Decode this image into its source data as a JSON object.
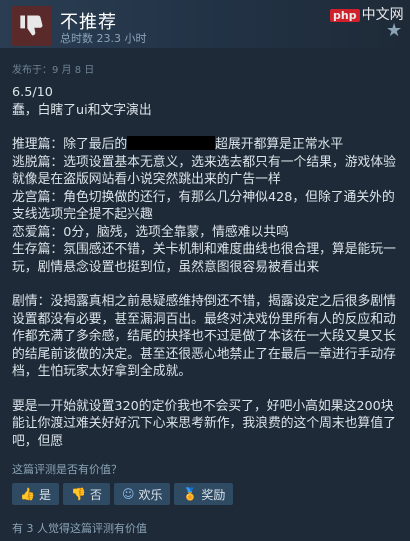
{
  "header": {
    "title": "不推荐",
    "hours": "总时数 23.3 小时",
    "watermark_tag": "php",
    "watermark_text": "中文网"
  },
  "posted": "发布于：9 月 8 日",
  "body": {
    "line1": "6.5/10",
    "line2": "蠢，白瞎了ui和文字演出",
    "line3a": "推理篇：除了最后的",
    "line3b": "超展开都算是正常水平",
    "line4": "逃脱篇：选项设置基本无意义，选来选去都只有一个结果，游戏体验就像是在盗版网站看小说突然跳出来的广告一样",
    "line5": "龙宫篇：角色切换做的还行，有那么几分神似428，但除了通关外的支线选项完全提不起兴趣",
    "line6": "恋爱篇：0分，脑残，选项全靠蒙，情感难以共鸣",
    "line7": "生存篇：氛围感还不错，关卡机制和难度曲线也很合理，算是能玩一玩，剧情悬念设置也挺到位，虽然意图很容易被看出来",
    "line8": "剧情：没揭露真相之前悬疑感维持倒还不错，揭露设定之后很多剧情设置都没有必要，甚至漏洞百出。最终对决戏份里所有人的反应和动作都充满了多余感，结尾的抉择也不过是做了本该在一大段又臭又长的结尾前该做的决定。甚至还很恶心地禁止了在最后一章进行手动存档，生怕玩家太好拿到全成就。",
    "line9": "要是一开始就设置320的定价我也不会买了，好吧小高如果这200块能让你渡过难关好好沉下心来思考新作，我浪费的这个周末也算值了吧，但愿"
  },
  "helpful_question": "这篇评测是否有价值？",
  "buttons": {
    "yes": "是",
    "no": "否",
    "funny": "欢乐",
    "award": "奖励"
  },
  "helpful_count": "有 3 人觉得这篇评测有价值"
}
